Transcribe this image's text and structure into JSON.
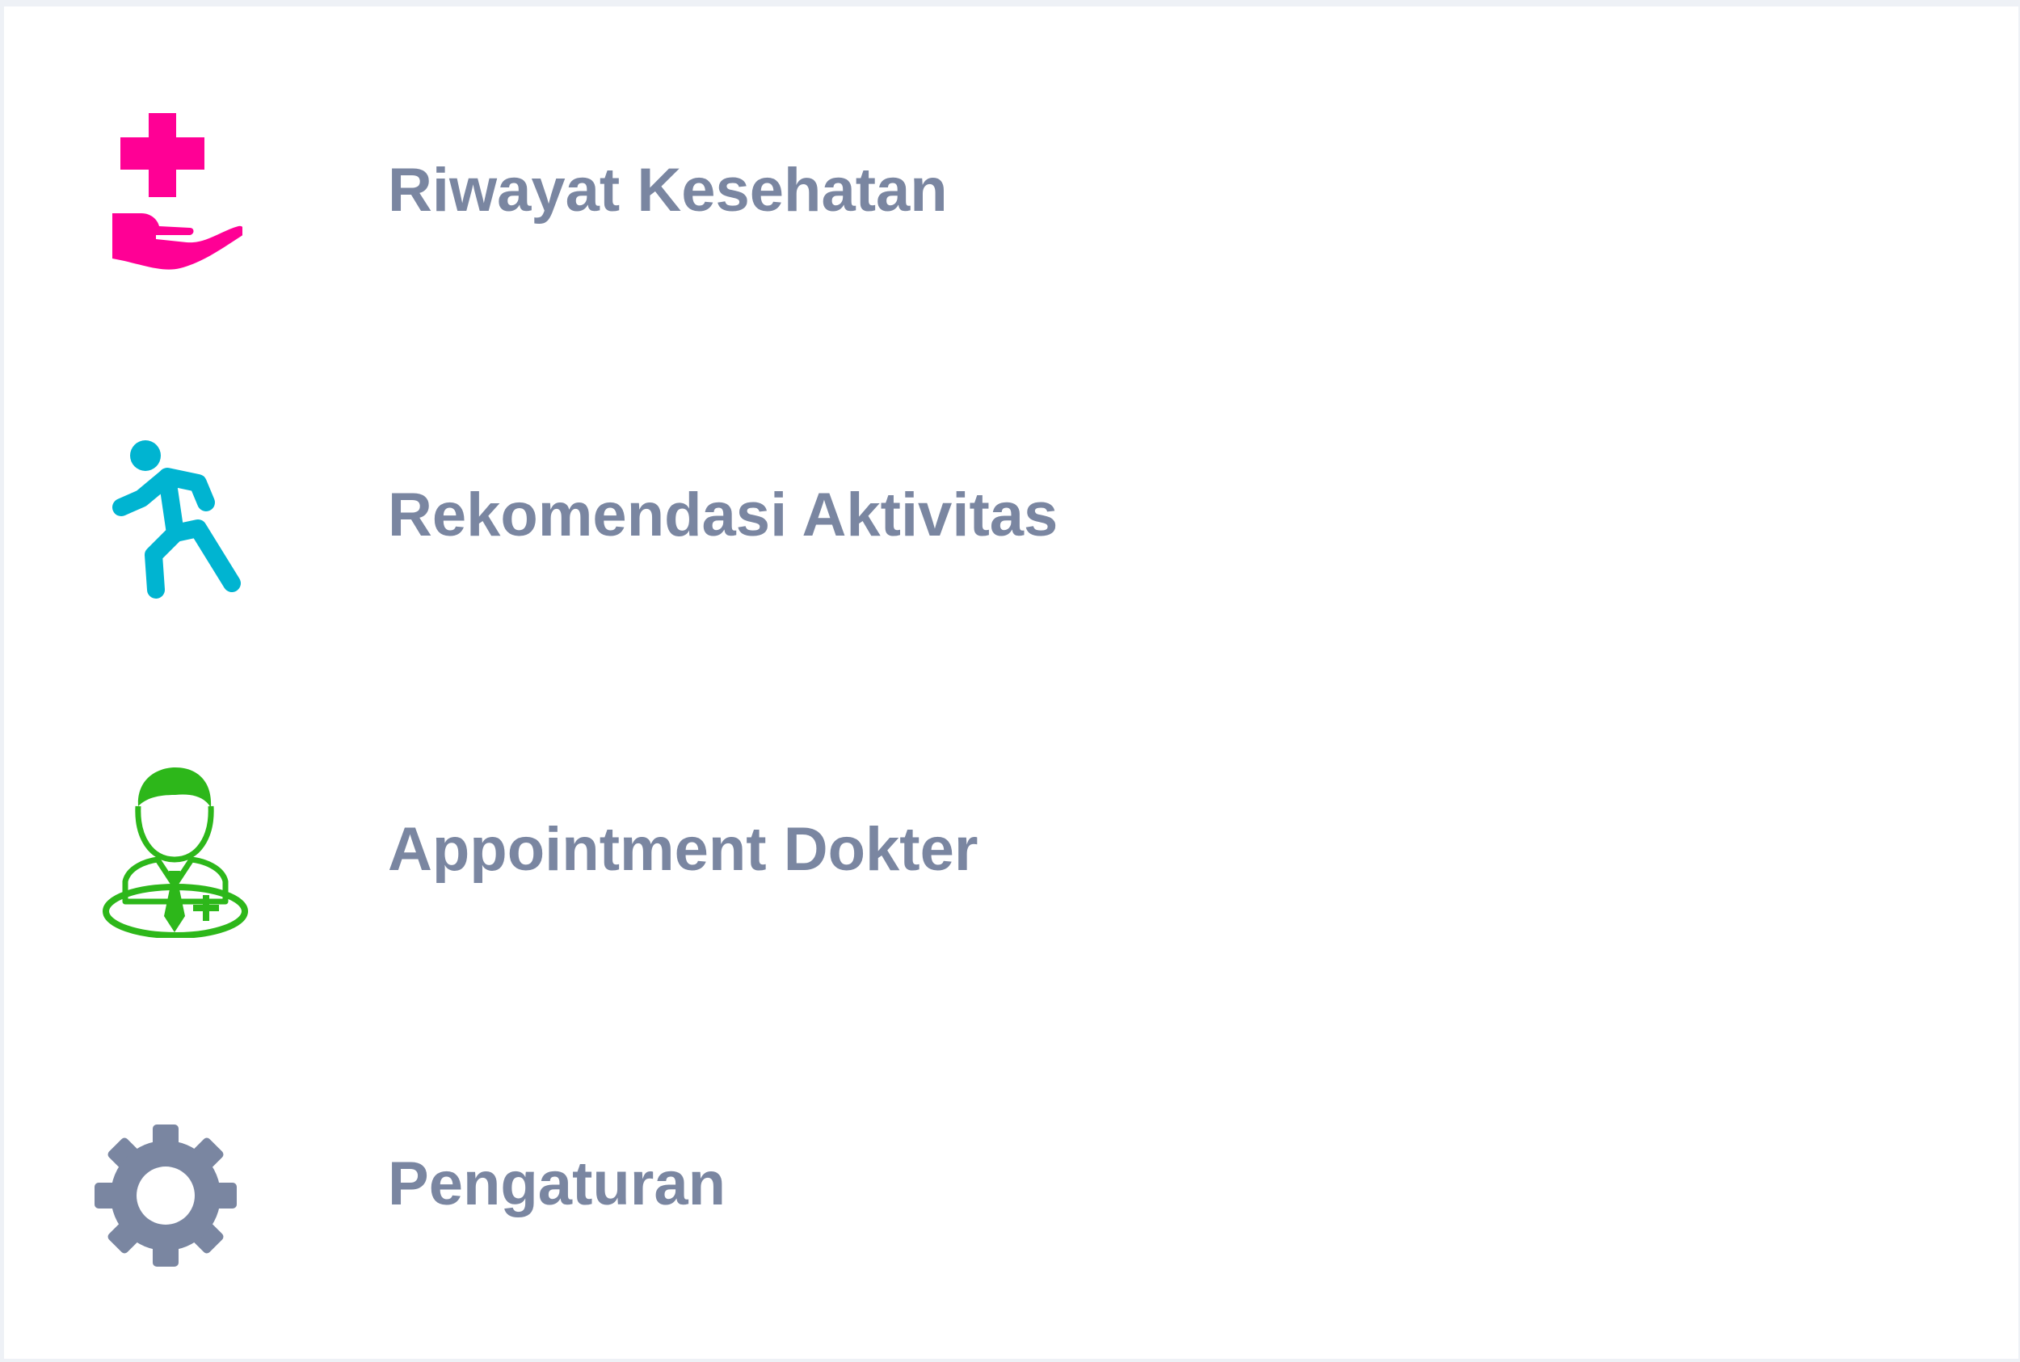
{
  "menu": {
    "items": [
      {
        "label": "Riwayat Kesehatan",
        "icon": "health-care-hand-icon",
        "icon_color": "#ff0095"
      },
      {
        "label": "Rekomendasi Aktivitas",
        "icon": "walking-person-icon",
        "icon_color": "#00b4d1"
      },
      {
        "label": "Appointment Dokter",
        "icon": "doctor-icon",
        "icon_color": "#2db71a"
      },
      {
        "label": "Pengaturan",
        "icon": "gear-icon",
        "icon_color": "#7a86a1"
      }
    ]
  },
  "colors": {
    "text": "#7a86a1",
    "background": "#ffffff",
    "frame": "#eef1f6"
  }
}
